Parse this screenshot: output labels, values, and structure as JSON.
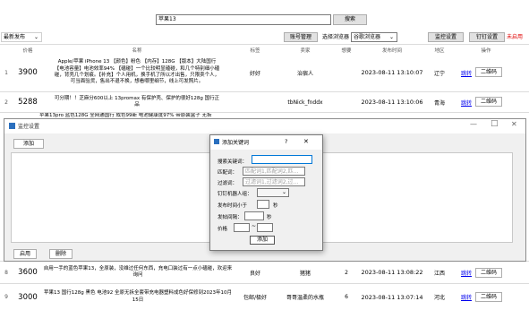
{
  "search": {
    "value": "苹果13",
    "button": "搜索"
  },
  "toolbar": {
    "sort_select": "最新发布",
    "account_btn": "账号管理",
    "browser_btn": "选择浏览器",
    "browser_select": "谷歌浏览器",
    "monitor_btn": "监控设置",
    "dingding_btn": "钉钉设置",
    "status": "未启用",
    "status_color": "#e00000"
  },
  "table": {
    "headers": [
      "价格",
      "名称",
      "标签",
      "卖家",
      "想要",
      "发布时间",
      "地区",
      "操作"
    ],
    "rows": [
      {
        "num": "1",
        "price": "3900",
        "name": "Apple/苹果 iPhone 13 【颜色】粉色 【内存】128G 【版本】大陆国行 【电池容量】电池效率94% 【磕碰】一个比较明显磕碰，和几个特别细小磕碰，背壳几个划痕。【补充】个人用机，换手机了所以才出售，只限卖个人，可当面验货，售出不退不换，想看哪里细节，线上可发照片。",
        "tag": "好好",
        "seller": "治宿人",
        "want": "",
        "time": "2023-08-11 13:10:07",
        "region": "辽宁",
        "link": "跳转",
        "qr": "二维码"
      },
      {
        "num": "2",
        "price": "5288",
        "name": "可分期！！芝麻分600以上 13promax 有保护壳、保护的很好128g 国行正品",
        "tag": "",
        "seller": "tbNick_fnddx",
        "want": "",
        "time": "2023-08-11 13:10:06",
        "region": "青海",
        "link": "跳转",
        "qr": "二维码"
      },
      {
        "num": "8",
        "price": "3600",
        "name": "自用一手的蓝色苹果13，全原装，没维过任何东西，充电口装过有一点小磕碰，欢迎来询问",
        "tag": "良好",
        "seller": "猪猪",
        "want": "2",
        "time": "2023-08-11 13:08:22",
        "region": "江西",
        "link": "跳转",
        "qr": "二维码"
      },
      {
        "num": "9",
        "price": "3000",
        "name": "苹果13 国行128g 黑色 电池92 全原无拆全套带充电器塑料成色好保修到2023年10月15日",
        "tag": "包邮/极好",
        "seller": "哥哥温柔的水瓶",
        "want": "6",
        "time": "2023-08-11 13:07:14",
        "region": "河北",
        "link": "跳转",
        "qr": "二维码"
      }
    ],
    "partial_row": "苹果13pro 蓝色128G 全网通国行 成色99新 电池健康度97% 带原装盒子 无拆"
  },
  "monitor_window": {
    "title": "监控设置",
    "add_btn": "添加",
    "start_btn": "启用",
    "delete_btn": "删除"
  },
  "dialog": {
    "title": "添加关键词",
    "help": "?",
    "close": "✕",
    "keyword_label": "搜索关键词：",
    "keyword_value": "",
    "match_label": "匹配词：",
    "match_placeholder": "匹配词1,匹配词2,匹…",
    "filter_label": "过滤词：",
    "filter_placeholder": "过滤词1,过滤词2,过…",
    "robot_label": "钉钉机器人组：",
    "robot_value": "",
    "within_label": "发布时间小于",
    "within_unit": "秒",
    "interval_label": "发帖间隔：",
    "interval_unit": "秒",
    "price_label": "价格",
    "price_sep": "~",
    "add_btn": "添加"
  }
}
